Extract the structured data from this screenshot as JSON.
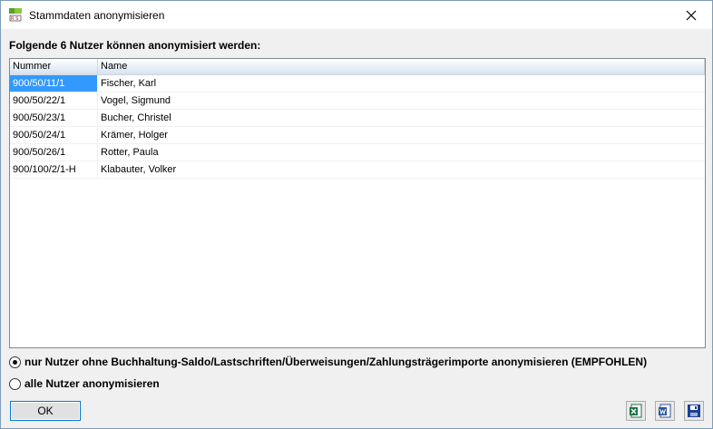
{
  "window": {
    "title": "Stammdaten anonymisieren",
    "app_icon": "db-icon",
    "close_icon": "close-icon"
  },
  "heading": "Folgende 6 Nutzer können anonymisiert werden:",
  "table": {
    "columns": [
      "Nummer",
      "Name"
    ],
    "rows": [
      {
        "nummer": "900/50/11/1",
        "name": "Fischer, Karl"
      },
      {
        "nummer": "900/50/22/1",
        "name": "Vogel, Sigmund"
      },
      {
        "nummer": "900/50/23/1",
        "name": "Bucher, Christel"
      },
      {
        "nummer": "900/50/24/1",
        "name": "Krämer, Holger"
      },
      {
        "nummer": "900/50/26/1",
        "name": "Rotter, Paula"
      },
      {
        "nummer": "900/100/2/1-H",
        "name": "Klabauter, Volker"
      }
    ],
    "selected_row": 0
  },
  "options": [
    {
      "label": "nur Nutzer ohne Buchhaltung-Saldo/Lastschriften/Überweisungen/Zahlungsträgerimporte anonymisieren (EMPFOHLEN)",
      "checked": true
    },
    {
      "label": "alle Nutzer anonymisieren",
      "checked": false
    }
  ],
  "buttons": {
    "ok_label": "OK",
    "tools": [
      "excel-export-icon",
      "word-export-icon",
      "save-icon"
    ]
  },
  "colors": {
    "selection": "#3399ff",
    "accent": "#0078d7"
  }
}
